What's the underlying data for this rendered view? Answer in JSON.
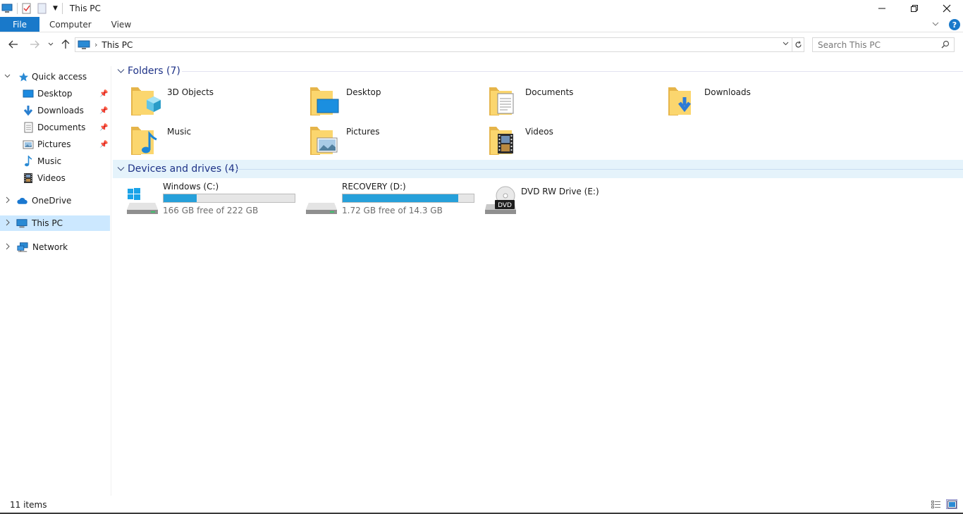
{
  "window": {
    "title": "This PC"
  },
  "ribbon": {
    "tabs": [
      {
        "label": "File"
      },
      {
        "label": "Computer"
      },
      {
        "label": "View"
      }
    ]
  },
  "address": {
    "crumbs": [
      "This PC"
    ]
  },
  "search": {
    "placeholder": "Search This PC"
  },
  "sidebar": {
    "items": [
      {
        "label": "Quick access",
        "icon": "star-icon"
      },
      {
        "label": "Desktop",
        "icon": "desktop-icon",
        "pinned": true
      },
      {
        "label": "Downloads",
        "icon": "download-arrow-icon",
        "pinned": true
      },
      {
        "label": "Documents",
        "icon": "document-icon",
        "pinned": true
      },
      {
        "label": "Pictures",
        "icon": "picture-icon",
        "pinned": true
      },
      {
        "label": "Music",
        "icon": "music-note-icon"
      },
      {
        "label": "Videos",
        "icon": "film-icon"
      },
      {
        "label": "OneDrive",
        "icon": "cloud-icon"
      },
      {
        "label": "This PC",
        "icon": "computer-icon",
        "selected": true
      },
      {
        "label": "Network",
        "icon": "network-icon"
      }
    ]
  },
  "groups": {
    "folders": {
      "title": "Folders (7)",
      "items": [
        {
          "label": "3D Objects",
          "icon": "3d-objects-folder-icon"
        },
        {
          "label": "Desktop",
          "icon": "desktop-folder-icon"
        },
        {
          "label": "Documents",
          "icon": "documents-folder-icon"
        },
        {
          "label": "Downloads",
          "icon": "downloads-folder-icon"
        },
        {
          "label": "Music",
          "icon": "music-folder-icon"
        },
        {
          "label": "Pictures",
          "icon": "pictures-folder-icon"
        },
        {
          "label": "Videos",
          "icon": "videos-folder-icon"
        }
      ]
    },
    "drives": {
      "title": "Devices and drives (4)",
      "items": [
        {
          "label": "Windows (C:)",
          "free_text": "166 GB free of 222 GB",
          "used_fraction": 0.25,
          "icon": "windows-drive-icon"
        },
        {
          "label": "RECOVERY (D:)",
          "free_text": "1.72 GB free of 14.3 GB",
          "used_fraction": 0.88,
          "icon": "hard-drive-icon"
        },
        {
          "label": "DVD RW Drive (E:)",
          "icon": "dvd-drive-icon",
          "dvd_text": "DVD"
        }
      ]
    }
  },
  "status": {
    "count": "11 items"
  },
  "colors": {
    "accent": "#1979ca",
    "selection": "#cce8ff",
    "bar_fill": "#26a0da",
    "group_title": "#1e3287"
  }
}
